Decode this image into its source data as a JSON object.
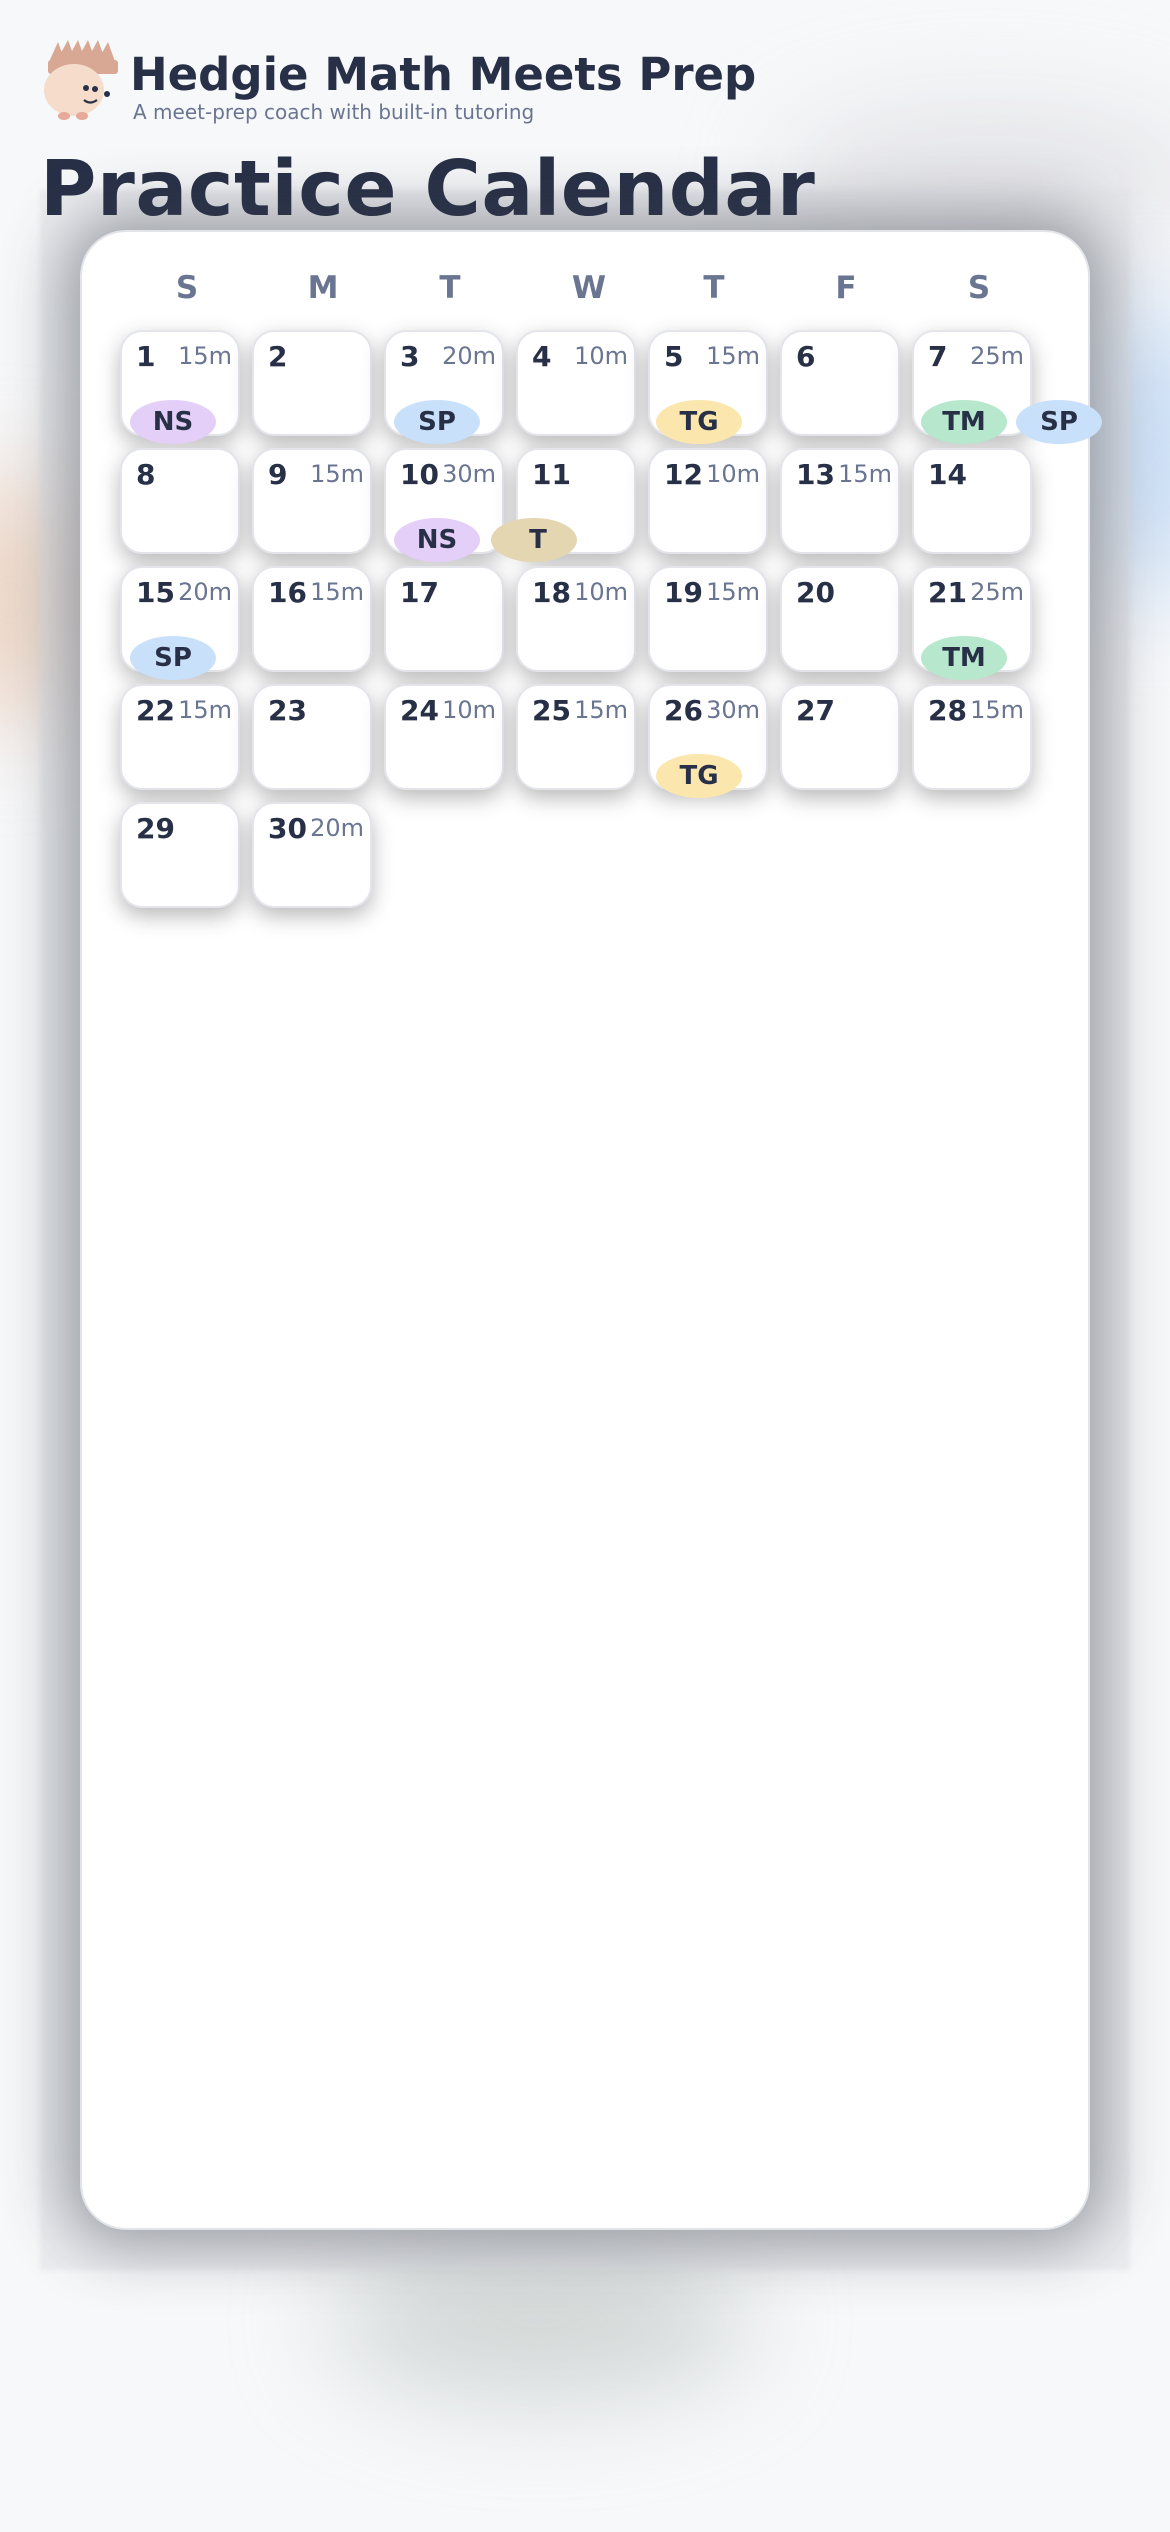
{
  "app": {
    "title": "Hedgie Math Meets Prep",
    "subtitle": "A meet-prep coach with built-in tutoring"
  },
  "page_title": "Practice Calendar",
  "weekdays": [
    "S",
    "M",
    "T",
    "W",
    "T",
    "F",
    "S"
  ],
  "days": [
    {
      "day": "1",
      "minutes": "15m"
    },
    {
      "day": "2",
      "minutes": ""
    },
    {
      "day": "3",
      "minutes": "20m"
    },
    {
      "day": "4",
      "minutes": "10m"
    },
    {
      "day": "5",
      "minutes": "15m"
    },
    {
      "day": "6",
      "minutes": ""
    },
    {
      "day": "7",
      "minutes": "25m"
    },
    {
      "day": "8",
      "minutes": ""
    },
    {
      "day": "9",
      "minutes": "15m"
    },
    {
      "day": "10",
      "minutes": "30m"
    },
    {
      "day": "11",
      "minutes": ""
    },
    {
      "day": "12",
      "minutes": "10m"
    },
    {
      "day": "13",
      "minutes": "15m"
    },
    {
      "day": "14",
      "minutes": ""
    },
    {
      "day": "15",
      "minutes": "20m"
    },
    {
      "day": "16",
      "minutes": "15m"
    },
    {
      "day": "17",
      "minutes": ""
    },
    {
      "day": "18",
      "minutes": "10m"
    },
    {
      "day": "19",
      "minutes": "15m"
    },
    {
      "day": "20",
      "minutes": ""
    },
    {
      "day": "21",
      "minutes": "25m"
    },
    {
      "day": "22",
      "minutes": "15m"
    },
    {
      "day": "23",
      "minutes": ""
    },
    {
      "day": "24",
      "minutes": "10m"
    },
    {
      "day": "25",
      "minutes": "15m"
    },
    {
      "day": "26",
      "minutes": "30m"
    },
    {
      "day": "27",
      "minutes": ""
    },
    {
      "day": "28",
      "minutes": "15m"
    },
    {
      "day": "29",
      "minutes": ""
    },
    {
      "day": "30",
      "minutes": "20m"
    }
  ],
  "events": [
    {
      "day": "1",
      "tag": "NS"
    },
    {
      "day": "3",
      "tag": "SP"
    },
    {
      "day": "5",
      "tag": "TG"
    },
    {
      "day": "7",
      "tag": "TM"
    },
    {
      "day": "7",
      "tag": "SP"
    },
    {
      "day": "10",
      "tag": "NS"
    },
    {
      "day": "10",
      "tag": "T"
    },
    {
      "day": "15",
      "tag": "SP"
    },
    {
      "day": "21",
      "tag": "TM"
    },
    {
      "day": "26",
      "tag": "TG"
    }
  ],
  "colors": {
    "NS": "#e3cff8",
    "SP": "#c9e0fa",
    "TG": "#fbe7ad",
    "TM": "#b7e7cc"
  }
}
